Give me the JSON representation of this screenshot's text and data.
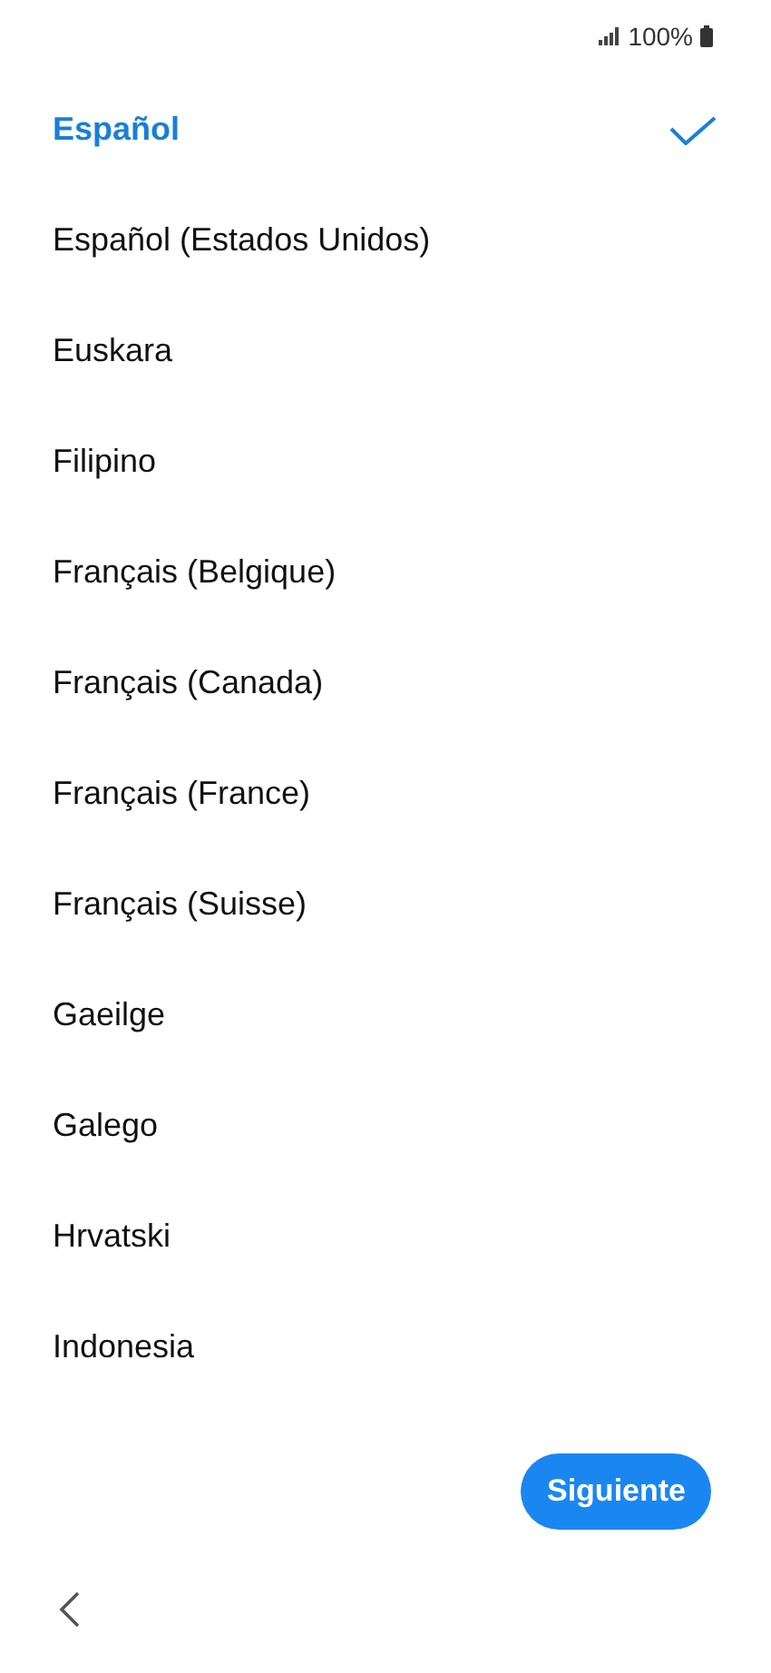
{
  "status_bar": {
    "battery": "100%"
  },
  "languages": [
    {
      "label": "Español",
      "selected": true
    },
    {
      "label": "Español (Estados Unidos)",
      "selected": false
    },
    {
      "label": "Euskara",
      "selected": false
    },
    {
      "label": "Filipino",
      "selected": false
    },
    {
      "label": "Français (Belgique)",
      "selected": false
    },
    {
      "label": "Français (Canada)",
      "selected": false
    },
    {
      "label": "Français (France)",
      "selected": false
    },
    {
      "label": "Français (Suisse)",
      "selected": false
    },
    {
      "label": "Gaeilge",
      "selected": false
    },
    {
      "label": "Galego",
      "selected": false
    },
    {
      "label": "Hrvatski",
      "selected": false
    },
    {
      "label": "Indonesia",
      "selected": false
    }
  ],
  "next_button": "Siguiente"
}
